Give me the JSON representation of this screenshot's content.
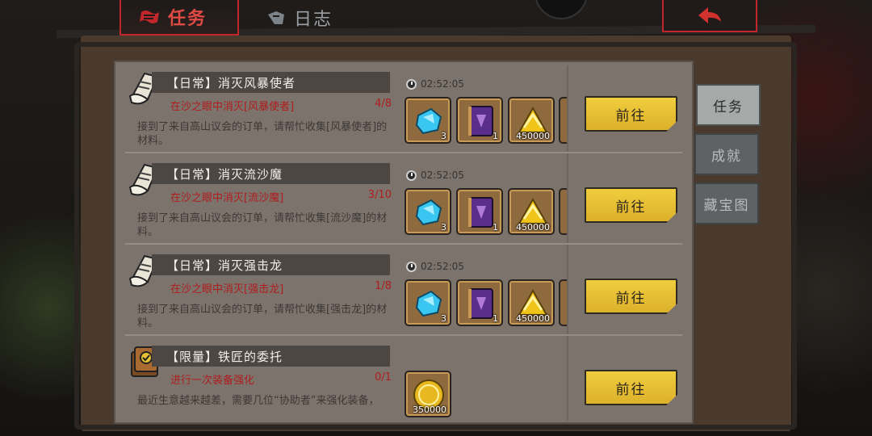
{
  "tabs": {
    "quest_label": "任务",
    "log_label": "日志"
  },
  "side_tabs": [
    "任务",
    "成就",
    "藏宝图"
  ],
  "quests": [
    {
      "title": "【日常】消灭风暴使者",
      "task": "在沙之眼中消灭[风暴使者]",
      "progress": "4/8",
      "description": "接到了来自高山议会的订单，请帮忙收集[风暴使者]的材料。",
      "timer": "02:52:05",
      "rewards": [
        {
          "icon": "crystal-icon",
          "count": "3"
        },
        {
          "icon": "spellbook-icon",
          "count": "1"
        },
        {
          "icon": "gold-pile-icon",
          "count": "450000"
        }
      ],
      "button": "前往"
    },
    {
      "title": "【日常】消灭流沙魔",
      "task": "在沙之眼中消灭[流沙魔]",
      "progress": "3/10",
      "description": "接到了来自高山议会的订单，请帮忙收集[流沙魔]的材料。",
      "timer": "02:52:05",
      "rewards": [
        {
          "icon": "crystal-icon",
          "count": "3"
        },
        {
          "icon": "spellbook-icon",
          "count": "1"
        },
        {
          "icon": "gold-pile-icon",
          "count": "450000"
        }
      ],
      "button": "前往"
    },
    {
      "title": "【日常】消灭强击龙",
      "task": "在沙之眼中消灭[强击龙]",
      "progress": "1/8",
      "description": "接到了来自高山议会的订单，请帮忙收集[强击龙]的材料。",
      "timer": "02:52:05",
      "rewards": [
        {
          "icon": "crystal-icon",
          "count": "3"
        },
        {
          "icon": "spellbook-icon",
          "count": "1"
        },
        {
          "icon": "gold-pile-icon",
          "count": "450000"
        }
      ],
      "button": "前往"
    },
    {
      "title": "【限量】铁匠的委托",
      "task": "进行一次装备强化",
      "progress": "0/1",
      "description": "最近生意越来越差，需要几位“协助者”来强化装备，",
      "rewards": [
        {
          "icon": "gold-coin-icon",
          "count": "350000"
        }
      ],
      "button": "前往"
    }
  ],
  "colors": {
    "active_tab_red": "#c0262b",
    "task_red": "#b01d1d",
    "button_yellow": "#e8c035",
    "crystal_blue": "#39c6f0",
    "book_purple": "#5a2f8c"
  }
}
